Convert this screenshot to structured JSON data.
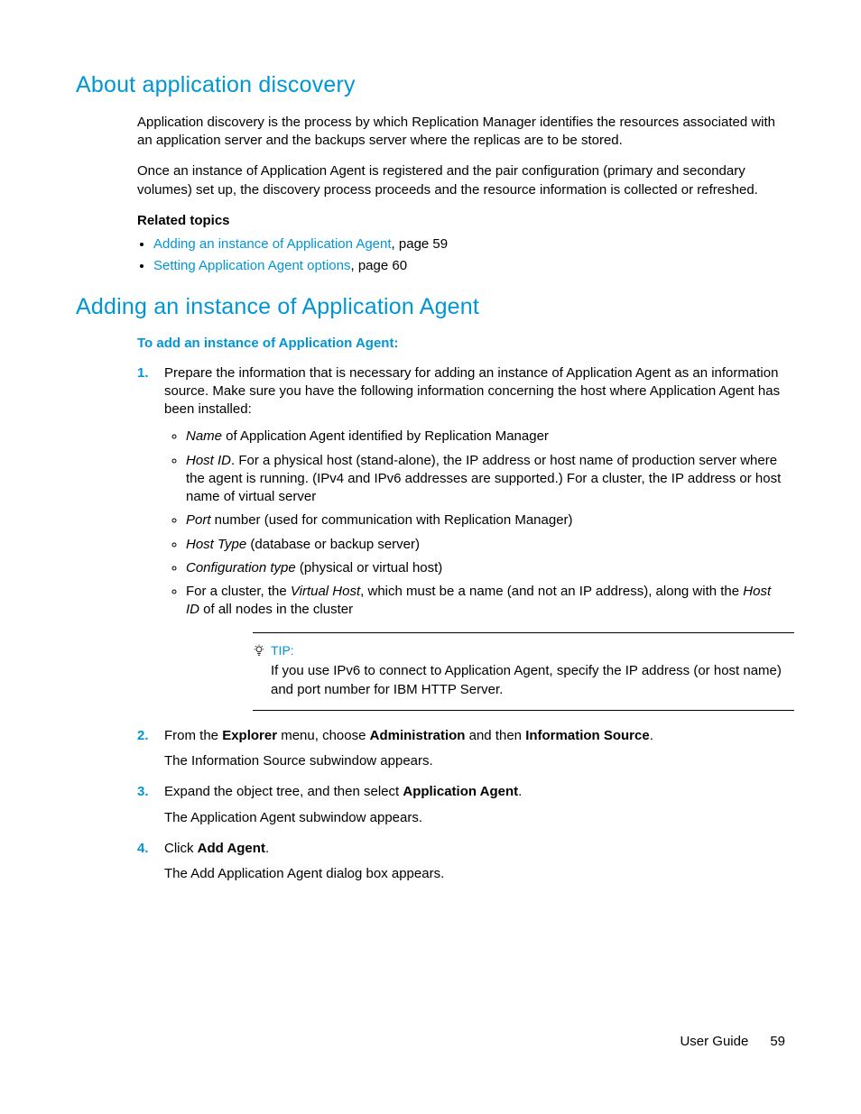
{
  "section1": {
    "heading": "About application discovery",
    "p1": "Application discovery is the process by which Replication Manager identifies the resources associated with an application server and the backups server where the replicas are to be stored.",
    "p2": "Once an instance of Application Agent is registered and the pair configuration (primary and secondary volumes) set up, the discovery process proceeds and the resource information is collected or refreshed.",
    "related_hdr": "Related topics",
    "related": [
      {
        "link": "Adding an instance of Application Agent",
        "suffix": ", page 59"
      },
      {
        "link": "Setting Application Agent options",
        "suffix": ", page 60"
      }
    ]
  },
  "section2": {
    "heading": "Adding an instance of Application Agent",
    "proc_title": "To add an instance of Application Agent:",
    "step1": {
      "text": "Prepare the information that is necessary for adding an instance of Application Agent as an information source. Make sure you have the following information concerning the host where Application Agent has been installed:",
      "b1_i": "Name",
      "b1_r": " of Application Agent identified by Replication Manager",
      "b2_i": "Host ID",
      "b2_r": ". For a physical host (stand-alone), the IP address or host name of production server where the agent is running. (IPv4 and IPv6 addresses are supported.) For a cluster, the IP address or host name of virtual server",
      "b3_i": "Port",
      "b3_r": " number (used for communication with Replication Manager)",
      "b4_i": "Host Type",
      "b4_r": " (database or backup server)",
      "b5_i": "Configuration type",
      "b5_r": " (physical or virtual host)",
      "b6_pre": "For a cluster, the ",
      "b6_i1": "Virtual Host",
      "b6_mid": ", which must be a name (and not an IP address), along with the ",
      "b6_i2": "Host ID",
      "b6_post": " of all nodes in the cluster"
    },
    "tip": {
      "label": "TIP:",
      "body": "If you use IPv6 to connect to Application Agent, specify the IP address (or host name) and port number for IBM HTTP Server."
    },
    "step2": {
      "pre": "From the ",
      "b1": "Explorer",
      "mid1": " menu, choose ",
      "b2": "Administration",
      "mid2": " and then ",
      "b3": "Information Source",
      "post": ".",
      "follow": "The Information Source subwindow appears."
    },
    "step3": {
      "pre": "Expand the object tree, and then select ",
      "b1": "Application Agent",
      "post": ".",
      "follow": "The Application Agent subwindow appears."
    },
    "step4": {
      "pre": "Click ",
      "b1": "Add Agent",
      "post": ".",
      "follow": "The Add Application Agent dialog box appears."
    }
  },
  "footer": {
    "title": "User Guide",
    "page": "59"
  }
}
